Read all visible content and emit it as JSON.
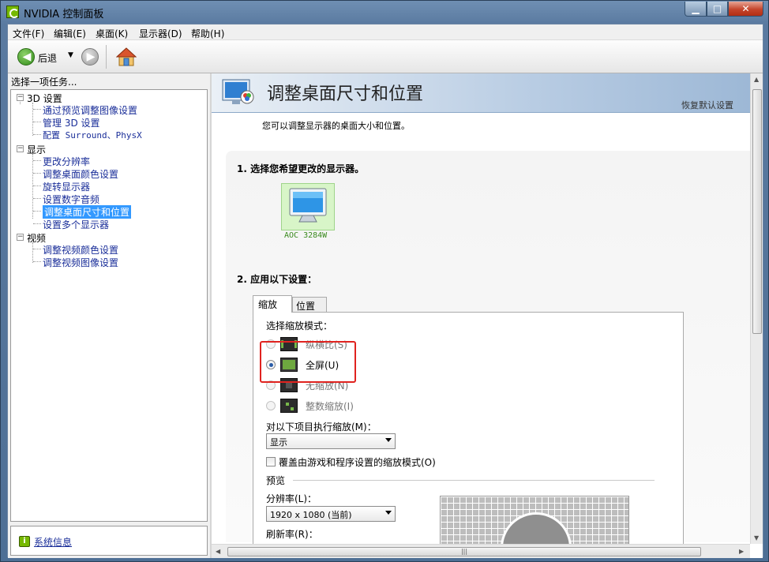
{
  "window": {
    "title": "NVIDIA 控制面板",
    "min": "▁",
    "max": "□",
    "close": "✕"
  },
  "menu": [
    "文件(F)",
    "编辑(E)",
    "桌面(K)",
    "显示器(D)",
    "帮助(H)"
  ],
  "toolbar": {
    "back_label": "后退",
    "dropdown_glyph": "▼"
  },
  "left": {
    "header": "选择一项任务...",
    "tree": {
      "cat_3d": "3D 设置",
      "items_3d": [
        "通过预览调整图像设置",
        "管理 3D 设置",
        "配置 Surround、PhysX"
      ],
      "cat_display": "显示",
      "items_display": [
        "更改分辨率",
        "调整桌面颜色设置",
        "旋转显示器",
        "设置数字音频",
        "调整桌面尺寸和位置",
        "设置多个显示器"
      ],
      "cat_video": "视频",
      "items_video": [
        "调整视频颜色设置",
        "调整视频图像设置"
      ]
    },
    "sysinfo": "系统信息"
  },
  "main": {
    "title": "调整桌面尺寸和位置",
    "restore": "恢复默认设置",
    "description": "您可以调整显示器的桌面大小和位置。",
    "step1": "1. 选择您希望更改的显示器。",
    "monitor_name": "AOC 3284W",
    "step2": "2. 应用以下设置：",
    "tabs": [
      "缩放",
      "位置"
    ],
    "scale_mode_label": "选择缩放模式：",
    "modes": [
      {
        "label": "纵横比(S)",
        "selected": false,
        "enabled": false
      },
      {
        "label": "全屏(U)",
        "selected": true,
        "enabled": true
      },
      {
        "label": "无缩放(N)",
        "selected": false,
        "enabled": false
      },
      {
        "label": "整数缩放(I)",
        "selected": false,
        "enabled": false
      }
    ],
    "perform_on_label": "对以下项目执行缩放(M)：",
    "perform_on_value": "显示",
    "override_label": "覆盖由游戏和程序设置的缩放模式(O)",
    "preview_label": "预览",
    "resolution_label": "分辨率(L)：",
    "resolution_value": "1920 x 1080 (当前)",
    "refresh_label": "刷新率(R)："
  },
  "colors": {
    "nvidia_green": "#76b900",
    "selection_blue": "#3399ff",
    "highlight_red": "#e0231f"
  }
}
